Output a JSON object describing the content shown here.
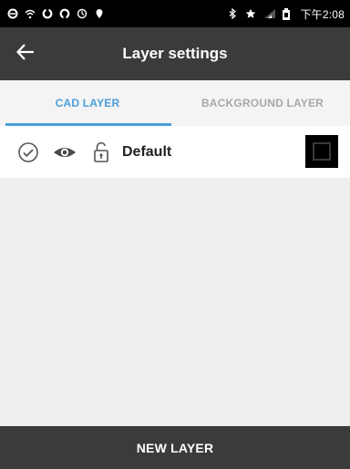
{
  "status_bar": {
    "time": "下午2:08",
    "icons": [
      "notification-icon",
      "wifi-icon",
      "sync-icon",
      "sync-icon",
      "clock-icon",
      "location-icon",
      "bluetooth-icon",
      "star-icon",
      "signal-icon",
      "battery-icon"
    ]
  },
  "app_bar": {
    "title": "Layer settings",
    "back_icon": "arrow-left-icon"
  },
  "tabs": [
    {
      "label": "CAD LAYER",
      "active": true
    },
    {
      "label": "BACKGROUND LAYER",
      "active": false
    }
  ],
  "layers": [
    {
      "name": "Default",
      "visible": true,
      "locked": false,
      "selected": true,
      "color": "#000000"
    }
  ],
  "footer": {
    "new_layer_label": "NEW LAYER"
  },
  "colors": {
    "app_bar": "#3b3b3b",
    "accent": "#4a9fdc",
    "background": "#efefef"
  }
}
